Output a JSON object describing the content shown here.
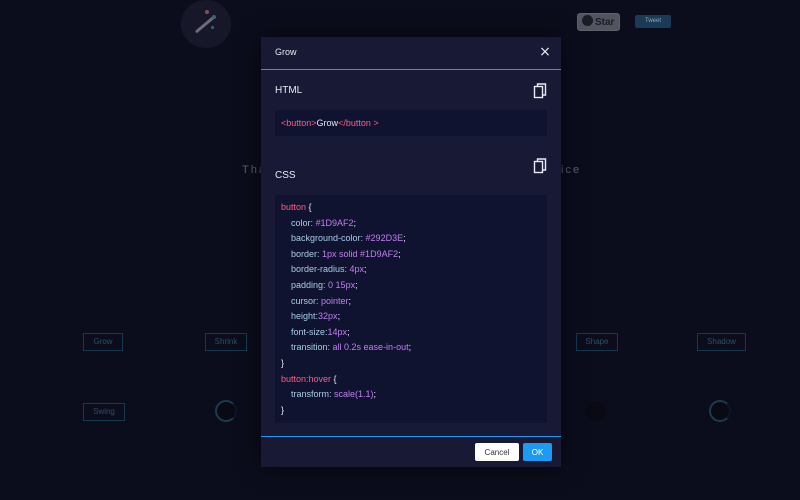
{
  "background": {
    "star_label": "Star",
    "tweet_label": "Tweet",
    "tagline_left": "Tha",
    "tagline_right": "ice",
    "buttons": {
      "grow": "Grow",
      "shrink": "Shrink",
      "shape": "Shape",
      "shadow": "Shadow",
      "swing": "Swing"
    }
  },
  "modal": {
    "title": "Grow",
    "close_glyph": "×",
    "html_label": "HTML",
    "css_label": "CSS",
    "html_code": {
      "open_tag": "<button>",
      "text": "Grow",
      "close_tag": "</button >"
    },
    "css_code": [
      [
        {
          "t": "button",
          "c": "sel"
        },
        {
          "t": " {",
          "c": "punc"
        }
      ],
      [
        {
          "t": "    color: ",
          "c": "prop"
        },
        {
          "t": "#1D9AF2",
          "c": "val"
        },
        {
          "t": ";",
          "c": "punc"
        }
      ],
      [
        {
          "t": "    background-color: ",
          "c": "prop"
        },
        {
          "t": "#292D3E",
          "c": "val"
        },
        {
          "t": ";",
          "c": "punc"
        }
      ],
      [
        {
          "t": "    border: ",
          "c": "prop"
        },
        {
          "t": "1px solid #1D9AF2",
          "c": "val"
        },
        {
          "t": ";",
          "c": "punc"
        }
      ],
      [
        {
          "t": "    border-radius: ",
          "c": "prop"
        },
        {
          "t": "4px",
          "c": "val"
        },
        {
          "t": ";",
          "c": "punc"
        }
      ],
      [
        {
          "t": "    padding: ",
          "c": "prop"
        },
        {
          "t": "0 15px",
          "c": "val"
        },
        {
          "t": ";",
          "c": "punc"
        }
      ],
      [
        {
          "t": "    cursor: ",
          "c": "prop"
        },
        {
          "t": "pointer",
          "c": "val"
        },
        {
          "t": ";",
          "c": "punc"
        }
      ],
      [
        {
          "t": "    height:",
          "c": "prop"
        },
        {
          "t": "32px",
          "c": "val"
        },
        {
          "t": ";",
          "c": "punc"
        }
      ],
      [
        {
          "t": "    font-size:",
          "c": "prop"
        },
        {
          "t": "14px",
          "c": "val"
        },
        {
          "t": ";",
          "c": "punc"
        }
      ],
      [
        {
          "t": "    transition: ",
          "c": "prop"
        },
        {
          "t": "all 0.2s ease-in-out",
          "c": "val"
        },
        {
          "t": ";",
          "c": "punc"
        }
      ],
      [
        {
          "t": "}",
          "c": "punc"
        }
      ],
      [
        {
          "t": "button:hover",
          "c": "sel"
        },
        {
          "t": " {",
          "c": "punc"
        }
      ],
      [
        {
          "t": "    transform: ",
          "c": "prop"
        },
        {
          "t": "scale(1.1)",
          "c": "val"
        },
        {
          "t": ";",
          "c": "punc"
        }
      ],
      [
        {
          "t": "}",
          "c": "punc"
        }
      ]
    ],
    "cancel_label": "Cancel",
    "ok_label": "OK"
  },
  "colors": {
    "accent": "#1D9AF2",
    "modal_bg": "#181A35",
    "code_bg": "#101330",
    "selector": "#FF5C84",
    "property": "#A7CDE6",
    "value": "#C47EF2"
  }
}
